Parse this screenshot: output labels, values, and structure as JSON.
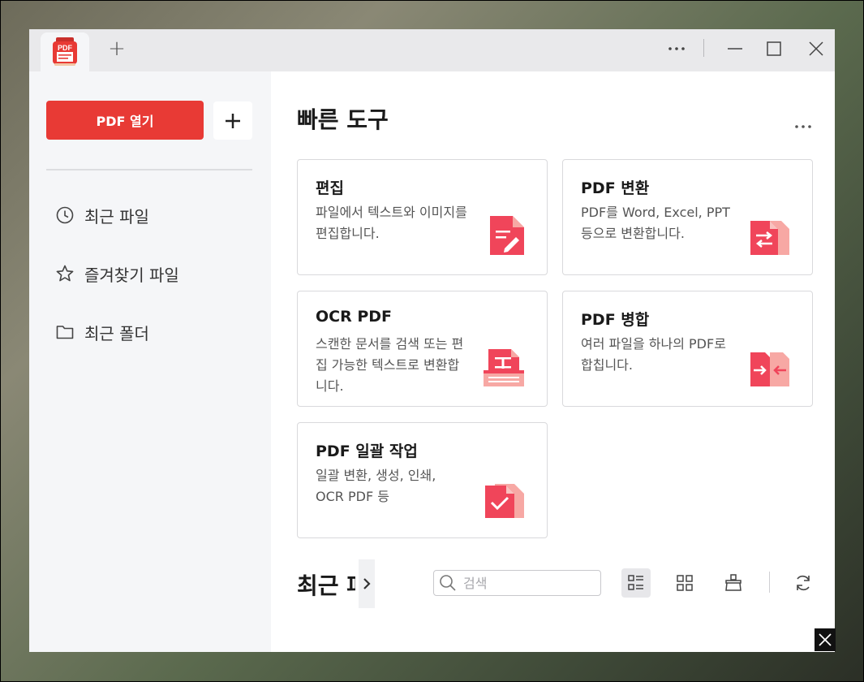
{
  "tabs": {
    "new_tab_symbol": "+",
    "logo_text": "PDF"
  },
  "window_controls": [
    "more-icon",
    "minimize-icon",
    "maximize-icon",
    "close-icon"
  ],
  "sidebar": {
    "open_pdf_label": "PDF 열기",
    "add_symbol": "+",
    "items": [
      {
        "label": "최근 파일",
        "icon": "clock-icon"
      },
      {
        "label": "즐겨찾기 파일",
        "icon": "star-icon"
      },
      {
        "label": "최근 폴더",
        "icon": "folder-icon"
      }
    ]
  },
  "quick_tools": {
    "title": "빠른 도구",
    "cards": [
      {
        "title": "편집",
        "desc": "파일에서 텍스트와 이미지를 편집합니다.",
        "icon": "edit-doc-icon"
      },
      {
        "title": "PDF 변환",
        "desc": "PDF를 Word, Excel, PPT 등으로 변환합니다.",
        "icon": "convert-doc-icon"
      },
      {
        "title": "OCR PDF",
        "desc": "스캔한 문서를 검색 또는 편집 가능한 텍스트로 변환합니다.",
        "icon": "ocr-doc-icon"
      },
      {
        "title": "PDF 병합",
        "desc": "여러 파일을 하나의 PDF로 합칩니다.",
        "icon": "merge-doc-icon"
      },
      {
        "title": "PDF 일괄 작업",
        "desc": "일괄 변환, 생성, 인쇄, OCR PDF 등",
        "icon": "batch-doc-icon"
      }
    ]
  },
  "recent": {
    "title": "최근 파일",
    "search_placeholder": "검색"
  },
  "colors": {
    "accent": "#e83a35",
    "icon_red": "#f0455a",
    "icon_light": "#f7a8a4"
  }
}
